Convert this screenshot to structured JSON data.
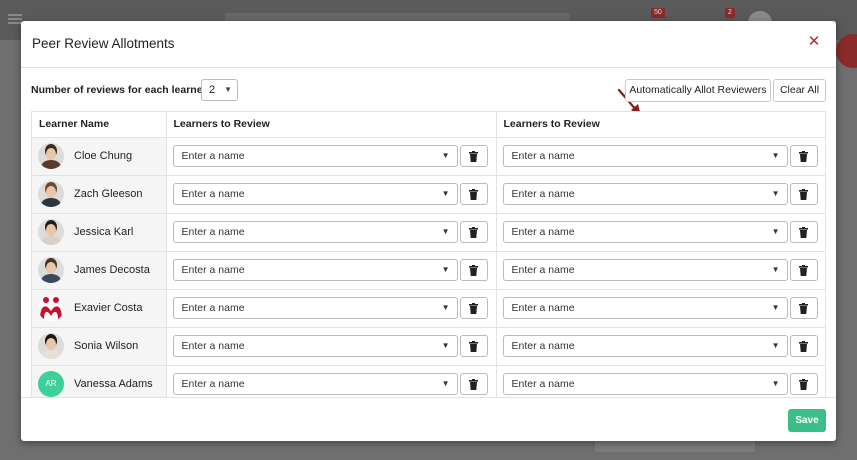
{
  "modal": {
    "title": "Peer Review Allotments",
    "close_glyph": "✕"
  },
  "controls": {
    "reviews_label": "Number of reviews for each learner",
    "reviews_value": "2",
    "auto_allot_label": "Automatically Allot Reviewers",
    "clear_all_label": "Clear All"
  },
  "table": {
    "headers": [
      "Learner Name",
      "Learners to Review",
      "Learners to Review"
    ],
    "placeholder": "Enter a name",
    "rows": [
      {
        "name": "Cloe Chung",
        "avatar": "photo"
      },
      {
        "name": "Zach Gleeson",
        "avatar": "photo"
      },
      {
        "name": "Jessica Karl",
        "avatar": "photo"
      },
      {
        "name": "James Decosta",
        "avatar": "photo"
      },
      {
        "name": "Exavier Costa",
        "avatar": "logo"
      },
      {
        "name": "Sonia Wilson",
        "avatar": "photo"
      },
      {
        "name": "Vanessa Adams",
        "avatar": "initials",
        "initials": "AR"
      }
    ]
  },
  "footer": {
    "save_label": "Save"
  },
  "background": {
    "badge_1": "50",
    "badge_2": "2"
  },
  "colors": {
    "accent_red": "#b22c2c",
    "save_green": "#3bbf8a",
    "initials_green": "#3fcf9a",
    "arrow": "#8b1a1a"
  },
  "icons": {
    "close": "close-icon",
    "delete": "trash-icon",
    "dropdown": "caret-down-icon",
    "annotation": "arrow-annotation"
  }
}
